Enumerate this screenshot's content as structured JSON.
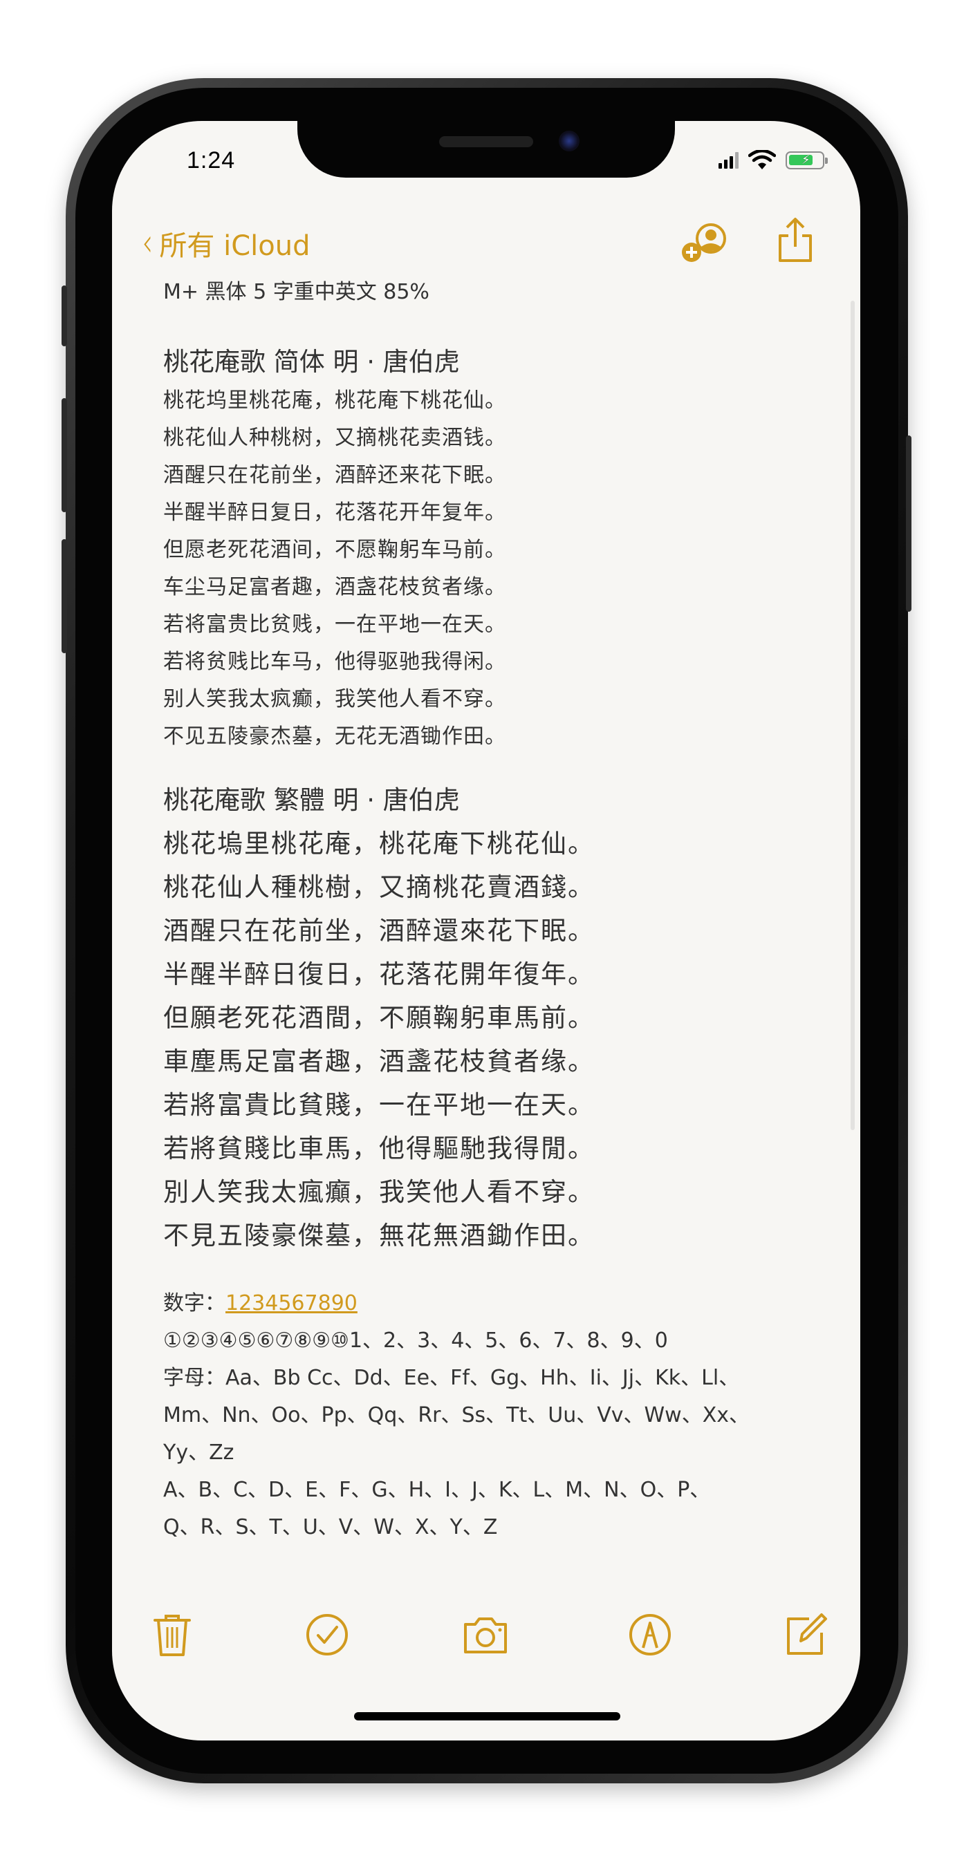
{
  "status": {
    "time": "1:24"
  },
  "nav": {
    "back_label": "所有 iCloud"
  },
  "note": {
    "font_label": "M+ 黑体 5 字重中英文 85%",
    "simplified": {
      "title": "桃花庵歌  简体   明 · 唐伯虎",
      "lines": [
        "桃花坞里桃花庵，桃花庵下桃花仙。",
        "桃花仙人种桃树，又摘桃花卖酒钱。",
        "酒醒只在花前坐，酒醉还来花下眠。",
        "半醒半醉日复日，花落花开年复年。",
        "但愿老死花酒间，不愿鞠躬车马前。",
        "车尘马足富者趣，酒盏花枝贫者缘。",
        "若将富贵比贫贱，一在平地一在天。",
        "若将贫贱比车马，他得驱驰我得闲。",
        "别人笑我太疯癫，我笑他人看不穿。",
        "不见五陵豪杰墓，无花无酒锄作田。"
      ]
    },
    "traditional": {
      "title": "桃花庵歌  繁體      明 · 唐伯虎",
      "lines": [
        "桃花塢里桃花庵，桃花庵下桃花仙。",
        "桃花仙人種桃樹，又摘桃花賣酒錢。",
        "酒醒只在花前坐，酒醉還來花下眠。",
        "半醒半醉日復日，花落花開年復年。",
        "但願老死花酒間，不願鞠躬車馬前。",
        "車塵馬足富者趣，酒盞花枝貧者缘。",
        "若將富貴比貧賤，一在平地一在天。",
        "若將貧賤比車馬，他得驅馳我得閒。",
        "別人笑我太瘋癲，我笑他人看不穿。",
        "不見五陵豪傑墓，無花無酒鋤作田。"
      ]
    },
    "numbers": {
      "label": "数字：",
      "link": "1234567890",
      "lines": [
        "①②③④⑤⑥⑦⑧⑨⑩1、2、3、4、5、6、7、8、9、0",
        "字母：Aa、Bb Cc、Dd、Ee、Ff、Gg、Hh、Ii、Jj、Kk、Ll、",
        "Mm、Nn、Oo、Pp、Qq、Rr、Ss、Tt、Uu、Vv、Ww、Xx、",
        "Yy、Zz",
        "A、B、C、D、E、F、G、H、I、J、K、L、M、N、O、P、",
        "Q、R、S、T、U、V、W、X、Y、Z"
      ]
    }
  },
  "colors": {
    "accent": "#d19a1e",
    "text": "#333333",
    "paper": "#f7f6f3",
    "battery": "#34c759"
  },
  "icons": {
    "back": "chevron-left-icon",
    "collaborate": "add-person-icon",
    "share": "share-icon",
    "delete": "trash-icon",
    "checklist": "checkmark-circle-icon",
    "camera": "camera-icon",
    "markup": "pen-tip-circle-icon",
    "compose": "compose-icon"
  }
}
